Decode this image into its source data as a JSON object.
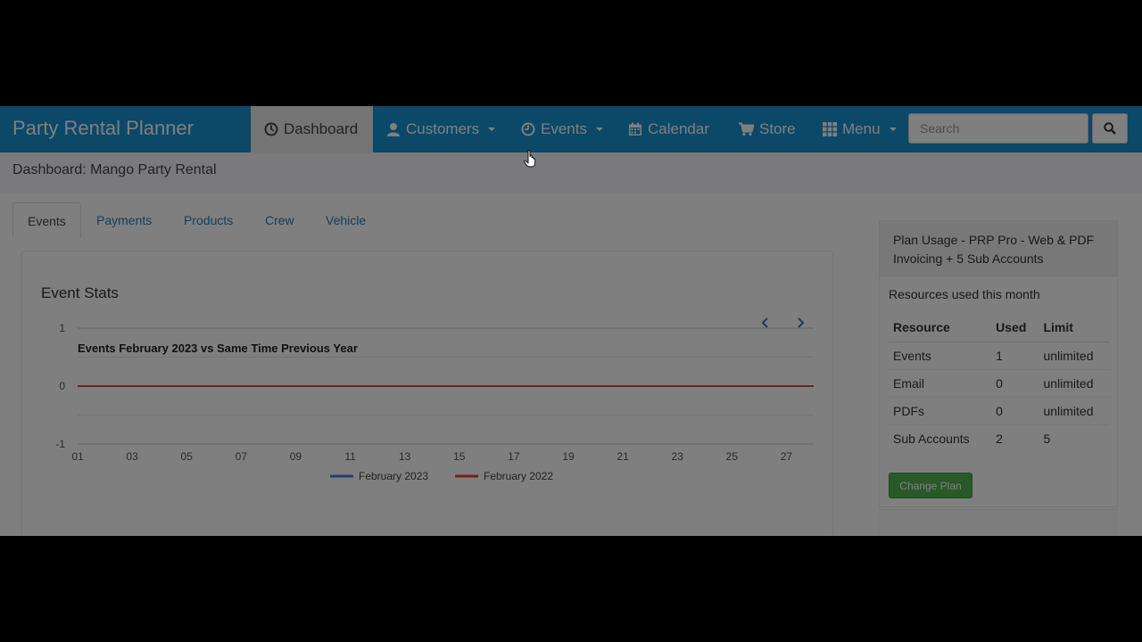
{
  "app": {
    "brand": "Party Rental Planner"
  },
  "nav": {
    "items": [
      {
        "label": "Dashboard",
        "icon": "dashboard-icon",
        "active": true
      },
      {
        "label": "Customers",
        "icon": "user-icon",
        "dropdown": true
      },
      {
        "label": "Events",
        "icon": "clock-icon",
        "dropdown": true
      },
      {
        "label": "Calendar",
        "icon": "calendar-icon"
      },
      {
        "label": "Store",
        "icon": "cart-icon"
      },
      {
        "label": "Menu",
        "icon": "grid-icon",
        "dropdown": true
      }
    ],
    "search": {
      "placeholder": "Search",
      "value": ""
    }
  },
  "page": {
    "title": "Dashboard: Mango Party Rental"
  },
  "tabs": [
    {
      "label": "Events",
      "active": true
    },
    {
      "label": "Payments"
    },
    {
      "label": "Products"
    },
    {
      "label": "Crew"
    },
    {
      "label": "Vehicle"
    }
  ],
  "stats": {
    "title": "Event Stats",
    "prev_icon": "chevron-left-icon",
    "next_icon": "chevron-right-icon"
  },
  "chart_data": {
    "type": "line",
    "title": "Events February 2023 vs Same Time Previous Year",
    "xlabel": "",
    "ylabel": "",
    "x": [
      "01",
      "02",
      "03",
      "04",
      "05",
      "06",
      "07",
      "08",
      "09",
      "10",
      "11",
      "12",
      "13",
      "14",
      "15",
      "16",
      "17",
      "18",
      "19",
      "20",
      "21",
      "22",
      "23",
      "24",
      "25",
      "26",
      "27",
      "28"
    ],
    "x_tick_labels": [
      "01",
      "03",
      "05",
      "07",
      "09",
      "11",
      "13",
      "15",
      "17",
      "19",
      "21",
      "23",
      "25",
      "27"
    ],
    "y_ticks": [
      "1",
      "0",
      "-1"
    ],
    "ylim": [
      -1,
      1
    ],
    "grid": true,
    "legend_position": "bottom",
    "series": [
      {
        "name": "February 2023",
        "color": "#4a7fd6",
        "values": [
          0,
          0,
          0,
          0,
          0,
          0,
          0,
          0,
          0,
          0,
          0,
          0,
          0,
          0,
          0,
          0,
          0,
          0,
          0,
          0,
          0,
          0,
          0,
          0,
          0,
          0,
          0,
          0
        ]
      },
      {
        "name": "February 2022",
        "color": "#e0472f",
        "values": [
          0,
          0,
          0,
          0,
          0,
          0,
          0,
          0,
          0,
          0,
          0,
          0,
          0,
          0,
          0,
          0,
          0,
          0,
          0,
          0,
          0,
          0,
          0,
          0,
          0,
          0,
          0,
          0
        ]
      }
    ]
  },
  "usage": {
    "heading": "Plan Usage - PRP Pro - Web & PDF Invoicing + 5 Sub Accounts",
    "subtitle": "Resources used this month",
    "columns": [
      "Resource",
      "Used",
      "Limit"
    ],
    "rows": [
      [
        "Events",
        "1",
        "unlimited"
      ],
      [
        "Email",
        "0",
        "unlimited"
      ],
      [
        "PDFs",
        "0",
        "unlimited"
      ],
      [
        "Sub Accounts",
        "2",
        "5"
      ]
    ],
    "button_label": "Change Plan"
  },
  "colors": {
    "navbar": "#1891d1",
    "accent_link": "#2a7ab8",
    "button_green": "#53b153",
    "overlay": "rgba(0,0,0,0.5)"
  }
}
